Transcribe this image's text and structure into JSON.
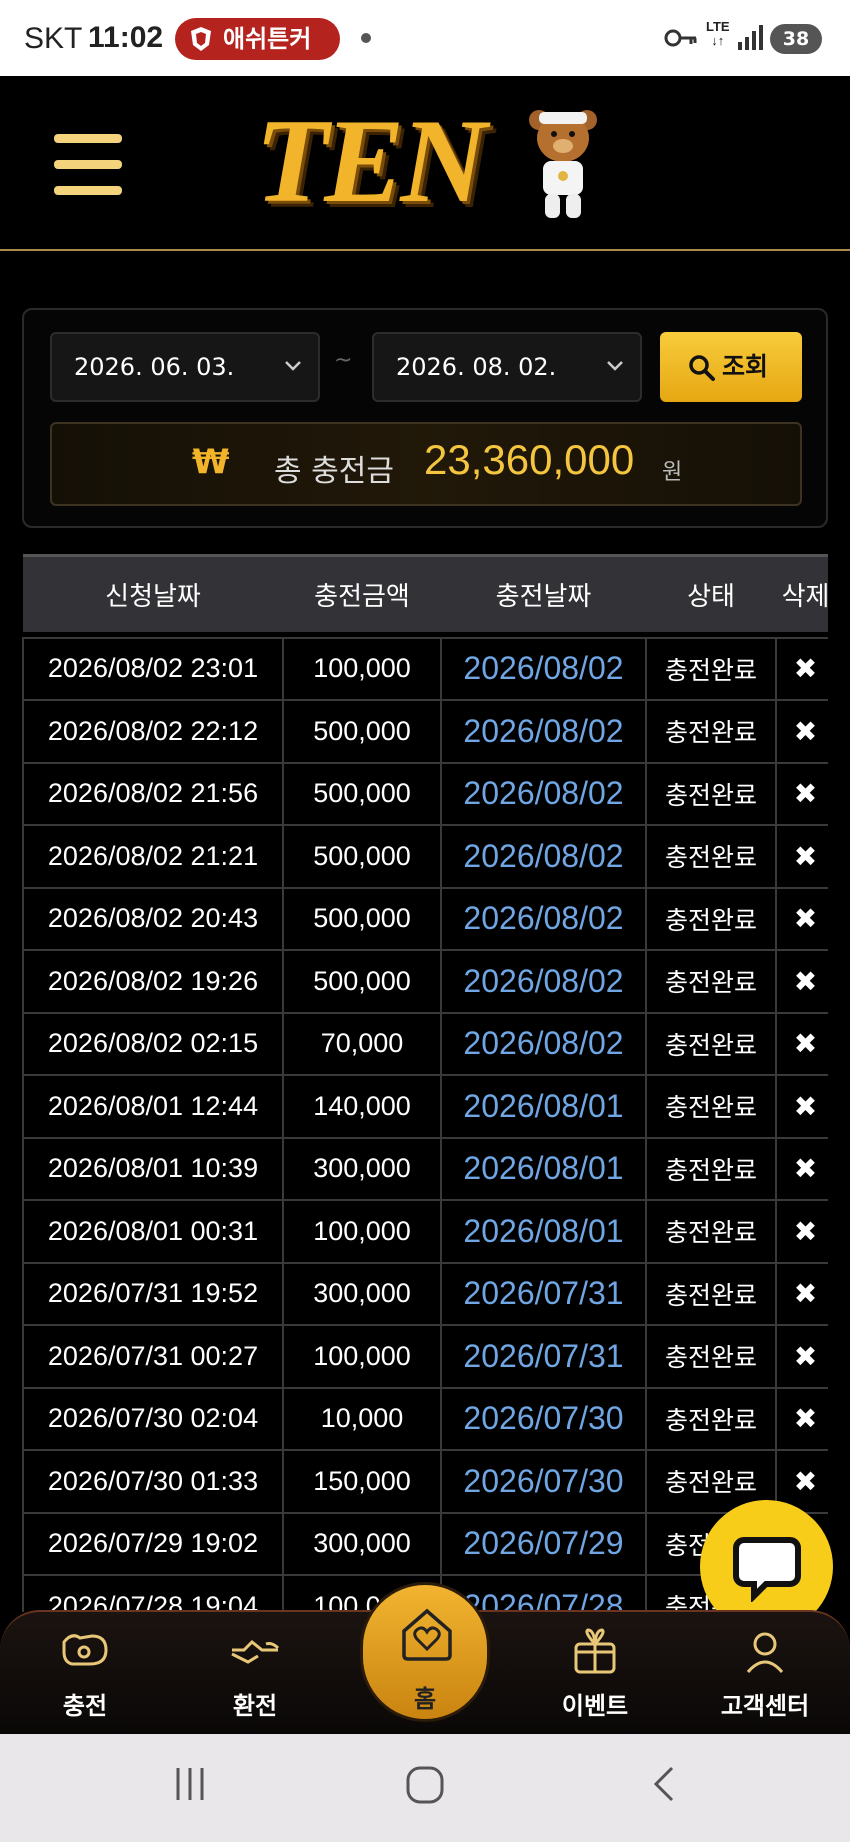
{
  "status_bar": {
    "carrier": "SKT",
    "time": "11:02",
    "notification_text": "애쉬튼커",
    "network": "LTE",
    "battery": "38"
  },
  "header": {
    "logo_text": "TEN"
  },
  "filter": {
    "date_from": "2026. 06. 03.",
    "separator": "~",
    "date_to": "2026. 08. 02.",
    "search_label": "조회",
    "total_icon": "₩",
    "total_label": "총 충전금",
    "total_amount": "23,360,000",
    "total_unit": "원"
  },
  "table": {
    "headers": [
      "신청날짜",
      "충전금액",
      "충전날짜",
      "상태",
      "삭제"
    ],
    "rows": [
      {
        "requested": "2026/08/02 23:01",
        "amount": "100,000",
        "charged": "2026/08/02",
        "status": "충전완료",
        "delete": "✖"
      },
      {
        "requested": "2026/08/02 22:12",
        "amount": "500,000",
        "charged": "2026/08/02",
        "status": "충전완료",
        "delete": "✖"
      },
      {
        "requested": "2026/08/02 21:56",
        "amount": "500,000",
        "charged": "2026/08/02",
        "status": "충전완료",
        "delete": "✖"
      },
      {
        "requested": "2026/08/02 21:21",
        "amount": "500,000",
        "charged": "2026/08/02",
        "status": "충전완료",
        "delete": "✖"
      },
      {
        "requested": "2026/08/02 20:43",
        "amount": "500,000",
        "charged": "2026/08/02",
        "status": "충전완료",
        "delete": "✖"
      },
      {
        "requested": "2026/08/02 19:26",
        "amount": "500,000",
        "charged": "2026/08/02",
        "status": "충전완료",
        "delete": "✖"
      },
      {
        "requested": "2026/08/02 02:15",
        "amount": "70,000",
        "charged": "2026/08/02",
        "status": "충전완료",
        "delete": "✖"
      },
      {
        "requested": "2026/08/01 12:44",
        "amount": "140,000",
        "charged": "2026/08/01",
        "status": "충전완료",
        "delete": "✖"
      },
      {
        "requested": "2026/08/01 10:39",
        "amount": "300,000",
        "charged": "2026/08/01",
        "status": "충전완료",
        "delete": "✖"
      },
      {
        "requested": "2026/08/01 00:31",
        "amount": "100,000",
        "charged": "2026/08/01",
        "status": "충전완료",
        "delete": "✖"
      },
      {
        "requested": "2026/07/31 19:52",
        "amount": "300,000",
        "charged": "2026/07/31",
        "status": "충전완료",
        "delete": "✖"
      },
      {
        "requested": "2026/07/31 00:27",
        "amount": "100,000",
        "charged": "2026/07/31",
        "status": "충전완료",
        "delete": "✖"
      },
      {
        "requested": "2026/07/30 02:04",
        "amount": "10,000",
        "charged": "2026/07/30",
        "status": "충전완료",
        "delete": "✖"
      },
      {
        "requested": "2026/07/30 01:33",
        "amount": "150,000",
        "charged": "2026/07/30",
        "status": "충전완료",
        "delete": "✖"
      },
      {
        "requested": "2026/07/29 19:02",
        "amount": "300,000",
        "charged": "2026/07/29",
        "status": "충전완료",
        "delete": "✖"
      },
      {
        "requested": "2026/07/28 19:04",
        "amount": "100,000",
        "charged": "2026/07/28",
        "status": "충전완료",
        "delete": "✖"
      }
    ]
  },
  "bottom_nav": {
    "charge": "충전",
    "exchange": "환전",
    "home": "홈",
    "event": "이벤트",
    "support": "고객센터"
  },
  "colors": {
    "accent": "#f2b42a",
    "charged_date": "#6fa6e3",
    "header_bg": "#333236",
    "chat_fab": "#f7cd1a"
  },
  "icons": [
    "menu-icon",
    "search-icon",
    "chevron-down-icon",
    "won-icon",
    "delete-icon",
    "charge-icon",
    "exchange-icon",
    "home-heart-icon",
    "gift-icon",
    "support-agent-icon",
    "chat-icon"
  ]
}
